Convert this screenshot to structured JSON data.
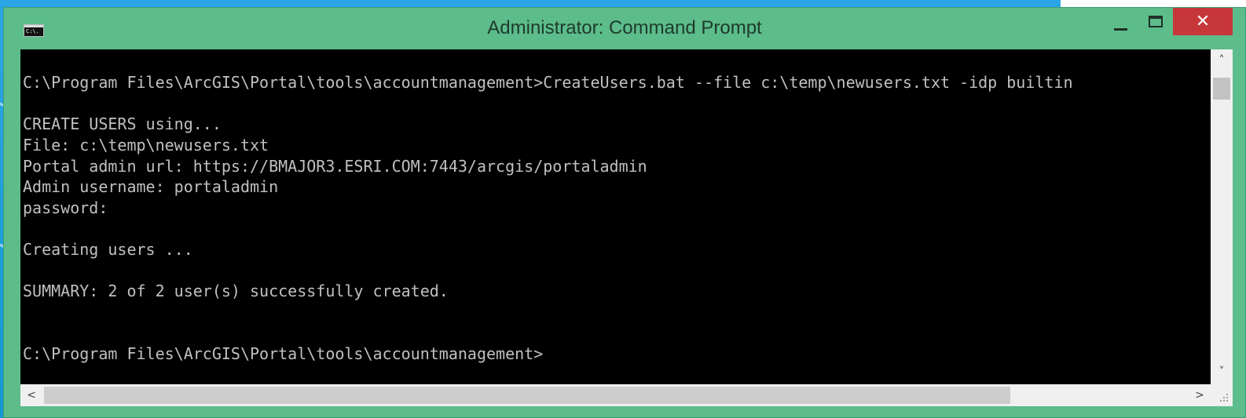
{
  "window": {
    "title": "Administrator: Command Prompt",
    "icon_name": "console-icon",
    "icon_text": "C:\\.",
    "minimize_icon": "minimize-icon",
    "maximize_icon": "maximize-icon",
    "close_icon": "close-icon",
    "close_symbol": "✕"
  },
  "console": {
    "lines": [
      "C:\\Program Files\\ArcGIS\\Portal\\tools\\accountmanagement>CreateUsers.bat --file c:\\temp\\newusers.txt -idp builtin",
      "",
      "CREATE USERS using...",
      "File: c:\\temp\\newusers.txt",
      "Portal admin url: https://BMAJOR3.ESRI.COM:7443/arcgis/portaladmin",
      "Admin username: portaladmin",
      "password:",
      "",
      "Creating users ...",
      "",
      "SUMMARY: 2 of 2 user(s) successfully created.",
      "",
      "",
      "C:\\Program Files\\ArcGIS\\Portal\\tools\\accountmanagement>"
    ]
  },
  "scrollbars": {
    "up_arrow": "˄",
    "down_arrow": "˅",
    "left_arrow": "<",
    "right_arrow": ">"
  },
  "colors": {
    "titlebar": "#5cbc8a",
    "close_button": "#c7373a",
    "console_bg": "#000000",
    "console_text": "#c0c0c0",
    "desktop": "#1ba1e2"
  }
}
